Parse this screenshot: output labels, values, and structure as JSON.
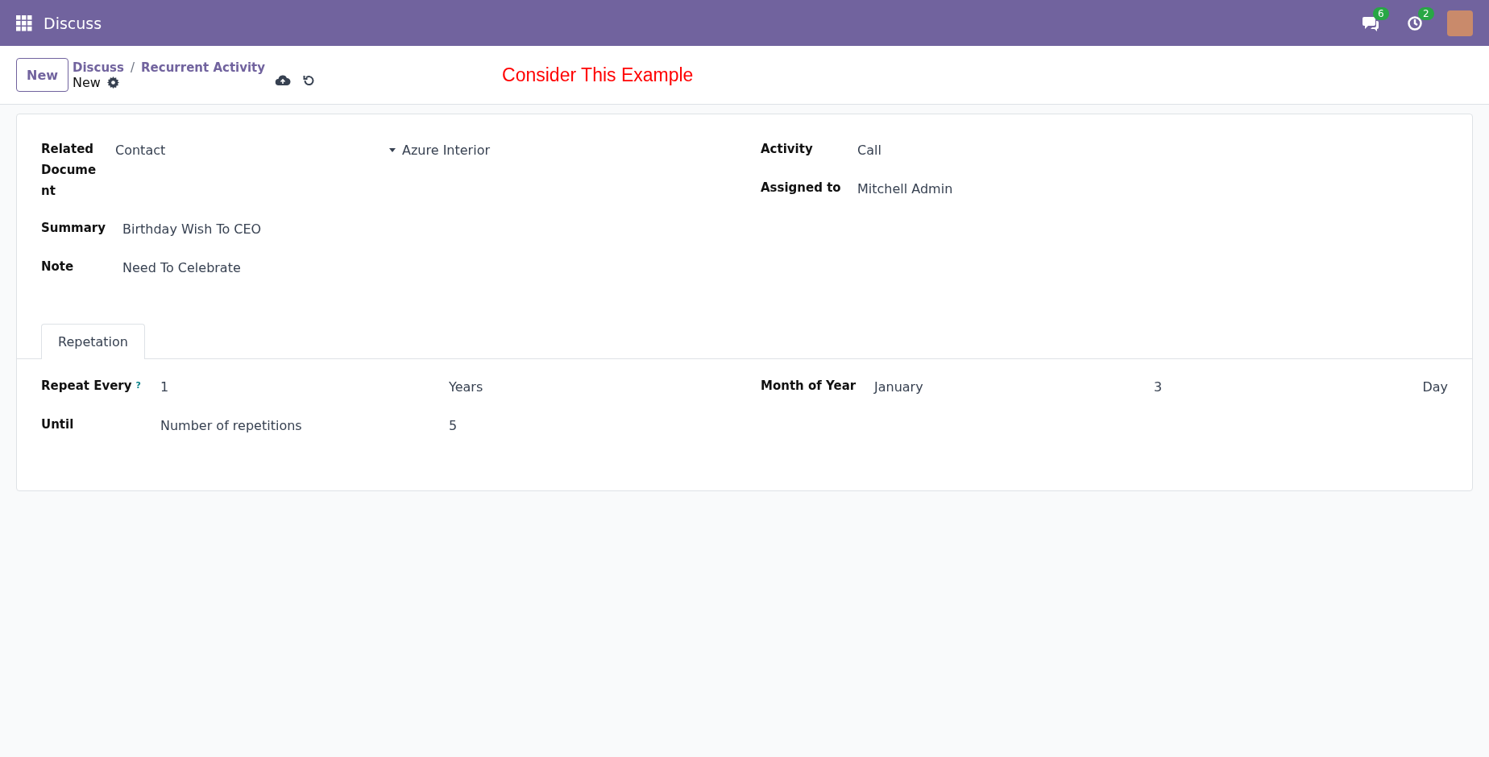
{
  "topbar": {
    "app_name": "Discuss",
    "chat_badge": "6",
    "activity_badge": "2"
  },
  "control_panel": {
    "new_button": "New",
    "breadcrumb": [
      "Discuss",
      "Recurrent Activity"
    ],
    "separator": "/",
    "record_name": "New"
  },
  "annotation": "Consider This Example",
  "form": {
    "related_document": {
      "label": "Related Document",
      "model": "Contact",
      "record": "Azure Interior"
    },
    "left_fields": [
      {
        "label": "Summary",
        "value": "Birthday Wish To CEO"
      },
      {
        "label": "Note",
        "value": "Need To Celebrate"
      }
    ],
    "right_fields": [
      {
        "label": "Activity",
        "value": "Call"
      },
      {
        "label": "Assigned to",
        "value": "Mitchell Admin"
      }
    ],
    "tabs": [
      {
        "label": "Repetation",
        "selected": true
      }
    ],
    "repeat_every": {
      "label": "Repeat Every",
      "help": "?",
      "value": "1",
      "unit": "Years"
    },
    "until": {
      "label": "Until",
      "value": "Number of repetitions",
      "count": "5"
    },
    "month_of_year": {
      "label": "Month of Year",
      "month": "January",
      "day": "3",
      "day_label": "Day"
    }
  }
}
